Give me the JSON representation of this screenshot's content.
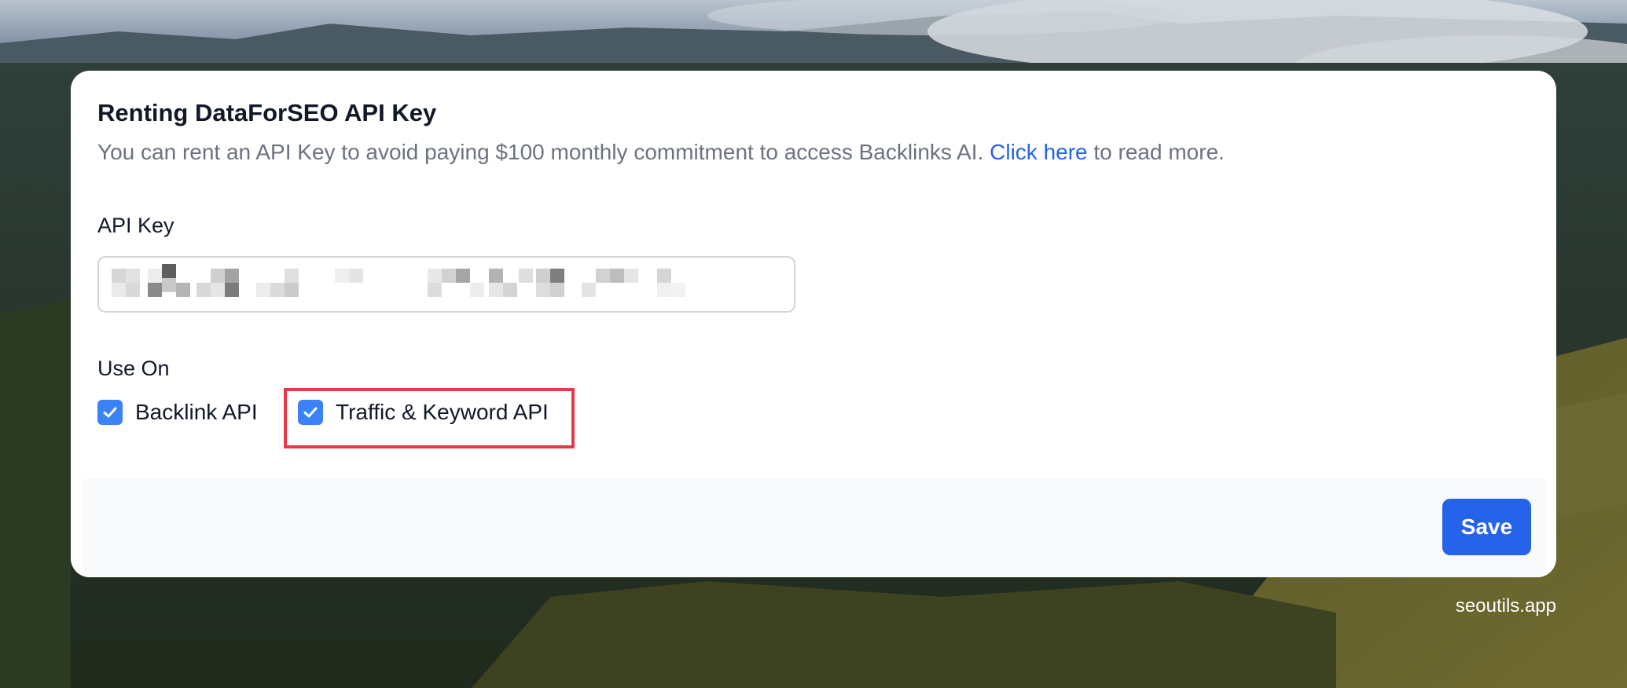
{
  "dialog": {
    "title": "Renting DataForSEO API Key",
    "description_prefix": "You can rent an API Key to avoid paying $100 monthly commitment to access Backlinks AI.",
    "link_text": "Click here",
    "description_suffix": "to read more.",
    "api_key_label": "API Key",
    "api_key_value": "",
    "use_on_label": "Use On",
    "options": [
      {
        "label": "Backlink API",
        "checked": true
      },
      {
        "label": "Traffic & Keyword API",
        "checked": true
      }
    ],
    "save_label": "Save"
  },
  "watermark": "seoutils.app",
  "colors": {
    "accent": "#2563eb",
    "checkbox": "#3b82f6",
    "highlight": "#e53945",
    "footer_bg": "#f9fafb"
  }
}
